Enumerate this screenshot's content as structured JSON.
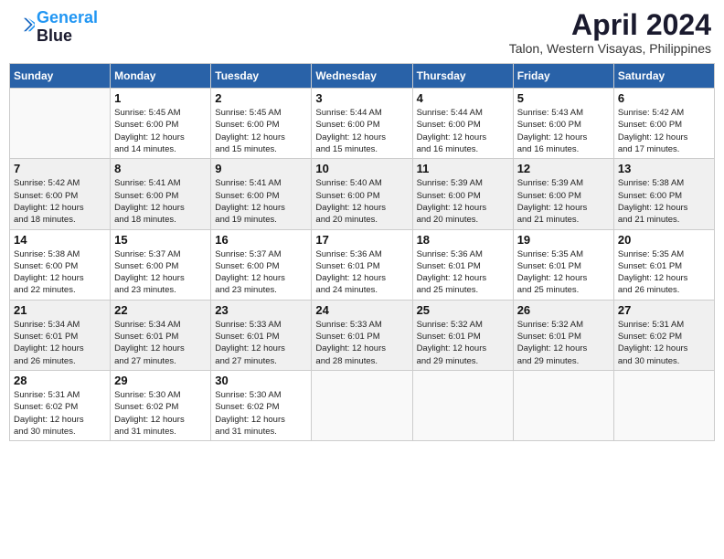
{
  "header": {
    "logo_line1": "General",
    "logo_line2": "Blue",
    "month": "April 2024",
    "location": "Talon, Western Visayas, Philippines"
  },
  "weekdays": [
    "Sunday",
    "Monday",
    "Tuesday",
    "Wednesday",
    "Thursday",
    "Friday",
    "Saturday"
  ],
  "weeks": [
    [
      {
        "day": "",
        "info": ""
      },
      {
        "day": "1",
        "info": "Sunrise: 5:45 AM\nSunset: 6:00 PM\nDaylight: 12 hours\nand 14 minutes."
      },
      {
        "day": "2",
        "info": "Sunrise: 5:45 AM\nSunset: 6:00 PM\nDaylight: 12 hours\nand 15 minutes."
      },
      {
        "day": "3",
        "info": "Sunrise: 5:44 AM\nSunset: 6:00 PM\nDaylight: 12 hours\nand 15 minutes."
      },
      {
        "day": "4",
        "info": "Sunrise: 5:44 AM\nSunset: 6:00 PM\nDaylight: 12 hours\nand 16 minutes."
      },
      {
        "day": "5",
        "info": "Sunrise: 5:43 AM\nSunset: 6:00 PM\nDaylight: 12 hours\nand 16 minutes."
      },
      {
        "day": "6",
        "info": "Sunrise: 5:42 AM\nSunset: 6:00 PM\nDaylight: 12 hours\nand 17 minutes."
      }
    ],
    [
      {
        "day": "7",
        "info": "Sunrise: 5:42 AM\nSunset: 6:00 PM\nDaylight: 12 hours\nand 18 minutes."
      },
      {
        "day": "8",
        "info": "Sunrise: 5:41 AM\nSunset: 6:00 PM\nDaylight: 12 hours\nand 18 minutes."
      },
      {
        "day": "9",
        "info": "Sunrise: 5:41 AM\nSunset: 6:00 PM\nDaylight: 12 hours\nand 19 minutes."
      },
      {
        "day": "10",
        "info": "Sunrise: 5:40 AM\nSunset: 6:00 PM\nDaylight: 12 hours\nand 20 minutes."
      },
      {
        "day": "11",
        "info": "Sunrise: 5:39 AM\nSunset: 6:00 PM\nDaylight: 12 hours\nand 20 minutes."
      },
      {
        "day": "12",
        "info": "Sunrise: 5:39 AM\nSunset: 6:00 PM\nDaylight: 12 hours\nand 21 minutes."
      },
      {
        "day": "13",
        "info": "Sunrise: 5:38 AM\nSunset: 6:00 PM\nDaylight: 12 hours\nand 21 minutes."
      }
    ],
    [
      {
        "day": "14",
        "info": "Sunrise: 5:38 AM\nSunset: 6:00 PM\nDaylight: 12 hours\nand 22 minutes."
      },
      {
        "day": "15",
        "info": "Sunrise: 5:37 AM\nSunset: 6:00 PM\nDaylight: 12 hours\nand 23 minutes."
      },
      {
        "day": "16",
        "info": "Sunrise: 5:37 AM\nSunset: 6:00 PM\nDaylight: 12 hours\nand 23 minutes."
      },
      {
        "day": "17",
        "info": "Sunrise: 5:36 AM\nSunset: 6:01 PM\nDaylight: 12 hours\nand 24 minutes."
      },
      {
        "day": "18",
        "info": "Sunrise: 5:36 AM\nSunset: 6:01 PM\nDaylight: 12 hours\nand 25 minutes."
      },
      {
        "day": "19",
        "info": "Sunrise: 5:35 AM\nSunset: 6:01 PM\nDaylight: 12 hours\nand 25 minutes."
      },
      {
        "day": "20",
        "info": "Sunrise: 5:35 AM\nSunset: 6:01 PM\nDaylight: 12 hours\nand 26 minutes."
      }
    ],
    [
      {
        "day": "21",
        "info": "Sunrise: 5:34 AM\nSunset: 6:01 PM\nDaylight: 12 hours\nand 26 minutes."
      },
      {
        "day": "22",
        "info": "Sunrise: 5:34 AM\nSunset: 6:01 PM\nDaylight: 12 hours\nand 27 minutes."
      },
      {
        "day": "23",
        "info": "Sunrise: 5:33 AM\nSunset: 6:01 PM\nDaylight: 12 hours\nand 27 minutes."
      },
      {
        "day": "24",
        "info": "Sunrise: 5:33 AM\nSunset: 6:01 PM\nDaylight: 12 hours\nand 28 minutes."
      },
      {
        "day": "25",
        "info": "Sunrise: 5:32 AM\nSunset: 6:01 PM\nDaylight: 12 hours\nand 29 minutes."
      },
      {
        "day": "26",
        "info": "Sunrise: 5:32 AM\nSunset: 6:01 PM\nDaylight: 12 hours\nand 29 minutes."
      },
      {
        "day": "27",
        "info": "Sunrise: 5:31 AM\nSunset: 6:02 PM\nDaylight: 12 hours\nand 30 minutes."
      }
    ],
    [
      {
        "day": "28",
        "info": "Sunrise: 5:31 AM\nSunset: 6:02 PM\nDaylight: 12 hours\nand 30 minutes."
      },
      {
        "day": "29",
        "info": "Sunrise: 5:30 AM\nSunset: 6:02 PM\nDaylight: 12 hours\nand 31 minutes."
      },
      {
        "day": "30",
        "info": "Sunrise: 5:30 AM\nSunset: 6:02 PM\nDaylight: 12 hours\nand 31 minutes."
      },
      {
        "day": "",
        "info": ""
      },
      {
        "day": "",
        "info": ""
      },
      {
        "day": "",
        "info": ""
      },
      {
        "day": "",
        "info": ""
      }
    ]
  ]
}
